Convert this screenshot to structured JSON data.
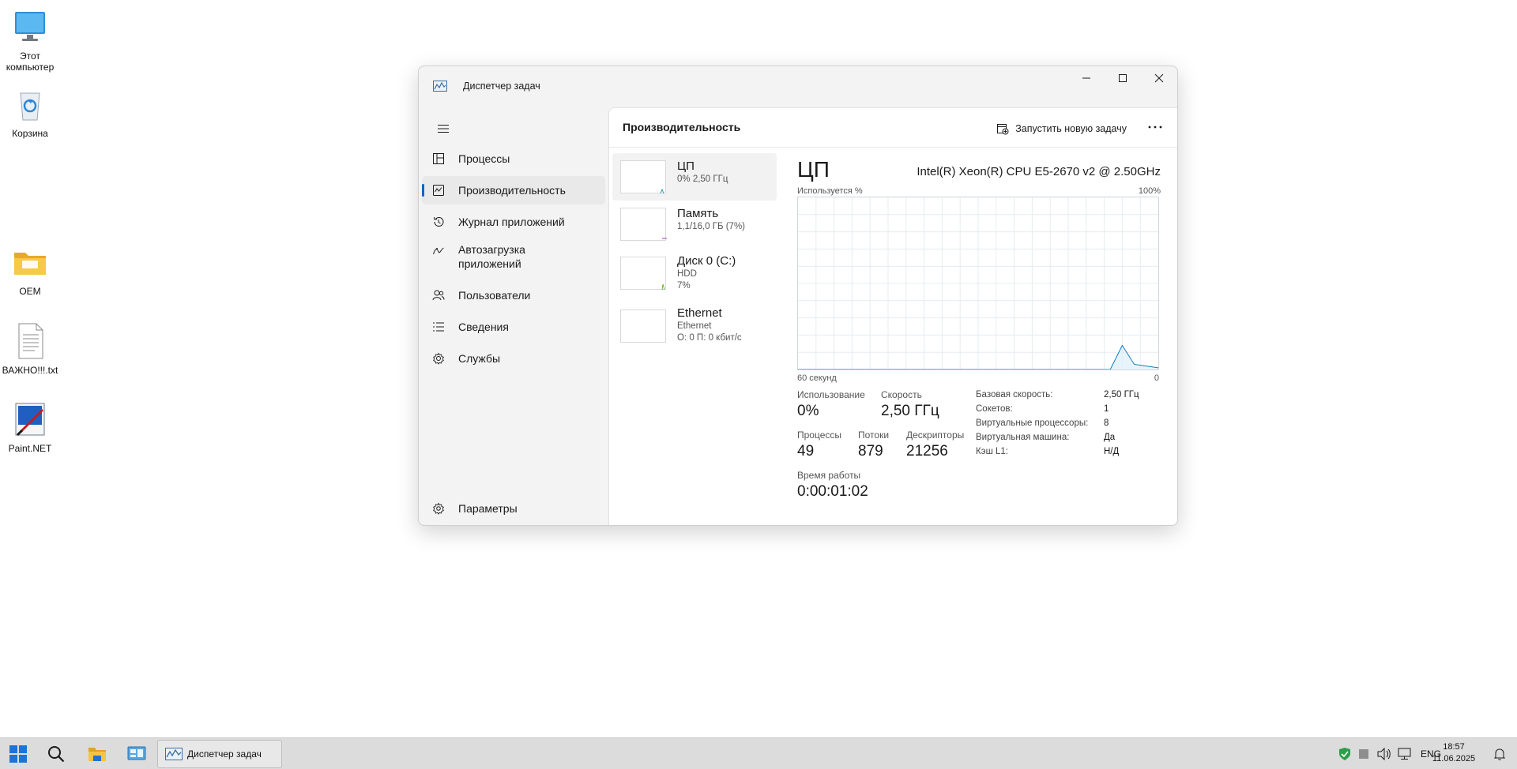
{
  "desktop": {
    "icons": [
      {
        "label": "Этот компьютер"
      },
      {
        "label": "Корзина"
      },
      {
        "label": "OEM"
      },
      {
        "label": "ВАЖНО!!!.txt"
      },
      {
        "label": "Paint.NET"
      }
    ]
  },
  "window": {
    "title": "Диспетчер задач",
    "controls": {
      "minimize": "minimize-icon",
      "maximize": "maximize-icon",
      "close": "close-icon"
    }
  },
  "nav": {
    "items": [
      {
        "label": "Процессы",
        "icon": "processes-icon"
      },
      {
        "label": "Производительность",
        "icon": "performance-icon",
        "active": true
      },
      {
        "label": "Журнал приложений",
        "icon": "history-icon"
      },
      {
        "label": "Автозагрузка приложений",
        "icon": "startup-icon"
      },
      {
        "label": "Пользователи",
        "icon": "users-icon"
      },
      {
        "label": "Сведения",
        "icon": "details-icon"
      },
      {
        "label": "Службы",
        "icon": "services-icon"
      }
    ],
    "settings_label": "Параметры"
  },
  "header": {
    "title": "Производительность",
    "run_task_label": "Запустить новую задачу"
  },
  "resources": [
    {
      "title": "ЦП",
      "sub1": "0% 2,50 ГГц",
      "sub2": ""
    },
    {
      "title": "Память",
      "sub1": "1,1/16,0 ГБ (7%)",
      "sub2": ""
    },
    {
      "title": "Диск 0 (C:)",
      "sub1": "HDD",
      "sub2": "7%"
    },
    {
      "title": "Ethernet",
      "sub1": "Ethernet",
      "sub2": "О: 0 П: 0 кбит/с"
    }
  ],
  "cpu": {
    "title": "ЦП",
    "model": "Intel(R) Xeon(R) CPU E5-2670 v2 @ 2.50GHz",
    "axis_top_left": "Используется %",
    "axis_top_right": "100%",
    "axis_bottom_left": "60 секунд",
    "axis_bottom_right": "0",
    "stats": {
      "usage_label": "Использование",
      "usage_value": "0%",
      "speed_label": "Скорость",
      "speed_value": "2,50 ГГц",
      "processes_label": "Процессы",
      "processes_value": "49",
      "threads_label": "Потоки",
      "threads_value": "879",
      "handles_label": "Дескрипторы",
      "handles_value": "21256",
      "uptime_label": "Время работы",
      "uptime_value": "0:00:01:02"
    },
    "info": [
      {
        "key": "Базовая скорость:",
        "value": "2,50 ГГц"
      },
      {
        "key": "Сокетов:",
        "value": "1"
      },
      {
        "key": "Виртуальные процессоры:",
        "value": "8"
      },
      {
        "key": "Виртуальная машина:",
        "value": "Да"
      },
      {
        "key": "Кэш L1:",
        "value": "Н/Д"
      }
    ]
  },
  "chart_data": {
    "type": "line",
    "title": "",
    "xlabel": "60 секунд",
    "ylabel": "Используется %",
    "xlim": [
      60,
      0
    ],
    "ylim": [
      0,
      100
    ],
    "grid": true,
    "series": [
      {
        "x": [
          60,
          8,
          6,
          4,
          2,
          0
        ],
        "values": [
          0,
          0,
          14,
          3,
          2,
          1
        ]
      }
    ]
  },
  "taskbar": {
    "active_window_label": "Диспетчер задач",
    "language": "ENG",
    "time": "18:57",
    "date": "11.06.2025"
  }
}
